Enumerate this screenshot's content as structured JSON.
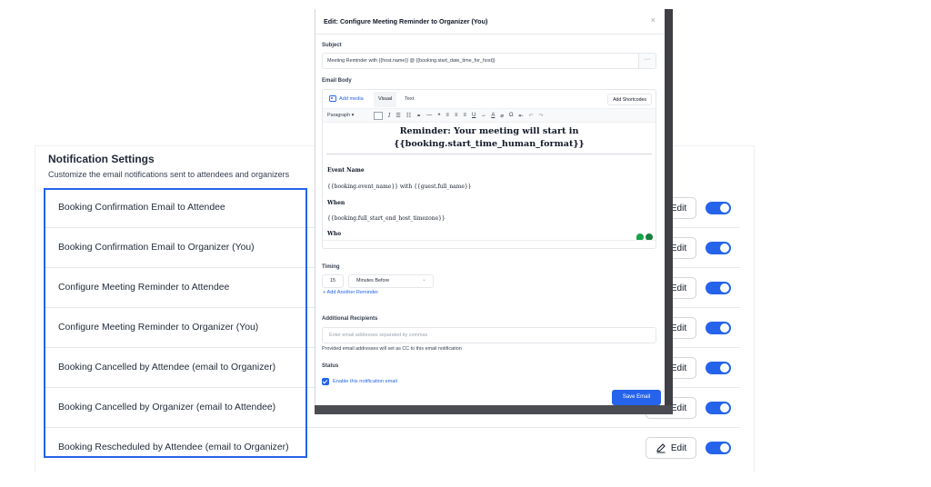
{
  "settings": {
    "title": "Notification Settings",
    "subtitle": "Customize the email notifications sent to attendees and organizers",
    "edit_label": "Edit",
    "rows": [
      {
        "label": "Booking Confirmation Email to Attendee",
        "enabled": true
      },
      {
        "label": "Booking Confirmation Email to Organizer (You)",
        "enabled": true
      },
      {
        "label": "Configure Meeting Reminder to Attendee",
        "enabled": true
      },
      {
        "label": "Configure Meeting Reminder to Organizer (You)",
        "enabled": true
      },
      {
        "label": "Booking Cancelled by Attendee (email to Organizer)",
        "enabled": true
      },
      {
        "label": "Booking Cancelled by Organizer (email to Attendee)",
        "enabled": true
      },
      {
        "label": "Booking Rescheduled by Attendee (email to Organizer)",
        "enabled": true
      }
    ]
  },
  "modal": {
    "title": "Edit: Configure Meeting Reminder to Organizer (You)",
    "close_glyph": "×",
    "subject_label": "Subject",
    "subject_value": "Meeting Reminder with {{host.name}} @ {{booking.start_date_time_for_host}}",
    "subject_more": "···",
    "body_label": "Email Body",
    "add_media": "Add media",
    "tab_visual": "Visual",
    "tab_text": "Text",
    "add_shortcodes": "Add Shortcodes",
    "paragraph": "Paragraph",
    "content": {
      "heading_line1": "Reminder: Your meeting will start in",
      "heading_line2": "{{booking.start_time_human_format}}",
      "event_name_label": "Event Name",
      "event_name_value": "{{booking.event_name}} with {{guest.full_name}}",
      "when_label": "When",
      "when_value": "{{booking.full_start_end_host_timezone}}",
      "who_label": "Who"
    },
    "timing_label": "Timing",
    "timing_value": "15",
    "timing_unit": "Minutes Before",
    "add_reminder": "+ Add Another Reminder",
    "recipients_label": "Additional Recipients",
    "recipients_placeholder": "Enter email addresses separated by commas",
    "recipients_help": "Provided email addresses will set as CC to this email notification",
    "status_label": "Status",
    "status_checkbox": "Enable this notification email",
    "status_checked": true,
    "save": "Save Email"
  },
  "colors": {
    "accent": "#2563eb",
    "text": "#1f2937",
    "border": "#e5e7eb"
  }
}
